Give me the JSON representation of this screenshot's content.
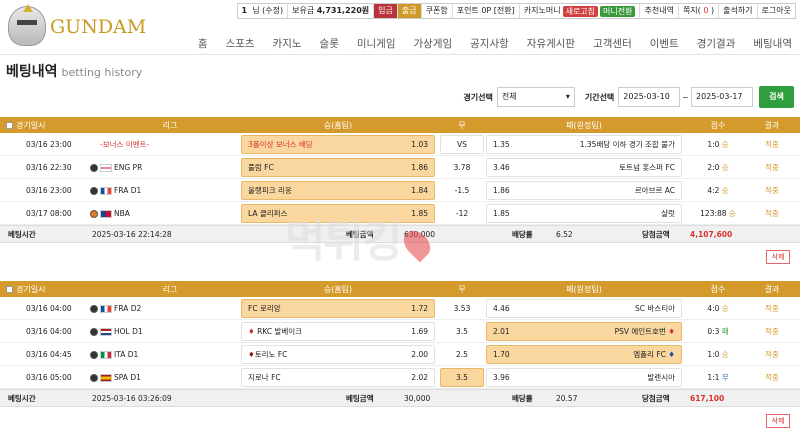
{
  "brand": {
    "name": "GUNDAM"
  },
  "topbar": {
    "level": "1",
    "user": "님 (수정)",
    "balance_label": "보유금",
    "balance": "4,731,220원",
    "deposit": "입금",
    "withdraw": "출금",
    "coupon": "쿠폰함",
    "point_label": "포인트",
    "point": "0P [전환]",
    "casino_label": "카지노머니",
    "casino_new": "새로고침",
    "mini": "머니전환",
    "recommend": "추천내역",
    "note_label": "쪽지(",
    "note": "0",
    "note_end": ")",
    "attendance": "출석하기",
    "logout": "로그아웃"
  },
  "nav": [
    "홈",
    "스포츠",
    "카지노",
    "슬롯",
    "미니게임",
    "가상게임",
    "공지사항",
    "자유게시판",
    "고객센터",
    "이벤트",
    "경기결과",
    "베팅내역"
  ],
  "page": {
    "title": "베팅내역",
    "subtitle": "betting history"
  },
  "filters": {
    "game_label": "경기선택",
    "game_value": "전체",
    "period_label": "기간선택",
    "from": "2025-03-10",
    "to": "2025-03-17",
    "search": "검색"
  },
  "headers": {
    "date": "경기일시",
    "league": "리그",
    "home": "승(홈팀)",
    "draw": "무",
    "away": "패(원정팀)",
    "score": "점수",
    "result": "결과"
  },
  "slips": [
    {
      "rows": [
        {
          "date": "03/16 23:00",
          "league": "-보너스 이벤트-",
          "home": "3폴이상 보너스 배당",
          "home_odds": "1.03",
          "draw": "VS",
          "away_odds": "1.35",
          "away": "1.35배당 이하 경기 조합 불가",
          "score": "1:0",
          "score_mark": "승",
          "result": "적중",
          "sel": "home"
        },
        {
          "date": "03/16 22:30",
          "league": "ENG PR",
          "home": "풀럼 FC",
          "home_odds": "1.86",
          "draw": "3.78",
          "away_odds": "3.46",
          "away": "토트넘 홋스퍼 FC",
          "score": "2:0",
          "score_mark": "승",
          "result": "적중",
          "sel": "home"
        },
        {
          "date": "03/16 23:00",
          "league": "FRA D1",
          "home": "올랭피크 리옹",
          "home_odds": "1.84",
          "draw": "-1.5",
          "away_odds": "1.86",
          "away": "르아브르 AC",
          "score": "4:2",
          "score_mark": "승",
          "result": "적중",
          "sel": "home"
        },
        {
          "date": "03/17 08:00",
          "league": "NBA",
          "home": "LA 클리퍼스",
          "home_odds": "1.85",
          "draw": "-12",
          "away_odds": "1.85",
          "away": "샬럿",
          "score": "123:88",
          "score_mark": "승",
          "result": "적중",
          "sel": "home"
        }
      ],
      "foot": {
        "time_label": "베팅시간",
        "time": "2025-03-16 22:14:28",
        "amount_label": "베팅금액",
        "amount": "630,000",
        "rate_label": "배당률",
        "rate": "6.52",
        "win_label": "당첨금액",
        "win": "4,107,600"
      },
      "delete": "삭제"
    },
    {
      "rows": [
        {
          "date": "03/16 04:00",
          "league": "FRA D2",
          "home": "FC 로리앙",
          "home_odds": "1.72",
          "draw": "3.53",
          "away_odds": "4.46",
          "away": "SC 바스티아",
          "score": "4:0",
          "score_mark": "승",
          "result": "적중",
          "sel": "home"
        },
        {
          "date": "03/16 04:00",
          "league": "HOL D1",
          "home": "RKC 발베이크",
          "home_odds": "1.69",
          "draw": "3.5",
          "away_odds": "2.01",
          "away": "PSV 에인트호번",
          "score": "0:3",
          "score_mark": "패",
          "result": "적중",
          "sel": "away"
        },
        {
          "date": "03/16 04:45",
          "league": "ITA D1",
          "home": "토리노 FC",
          "home_odds": "2.00",
          "draw": "2.5",
          "away_odds": "1.70",
          "away": "엠폴리 FC",
          "score": "1:0",
          "score_mark": "승",
          "result": "적중",
          "sel": "away"
        },
        {
          "date": "03/16 05:00",
          "league": "SPA D1",
          "home": "지로나 FC",
          "home_odds": "2.02",
          "draw": "3.5",
          "away_odds": "3.96",
          "away": "발렌시아",
          "score": "1:1",
          "score_mark": "무",
          "result": "적중",
          "sel": "draw"
        }
      ],
      "foot": {
        "time_label": "베팅시간",
        "time": "2025-03-16 03:26:09",
        "amount_label": "베팅금액",
        "amount": "30,000",
        "rate_label": "배당률",
        "rate": "20.57",
        "win_label": "당첨금액",
        "win": "617,100"
      },
      "delete": "삭제"
    }
  ],
  "watermark": "먹튀킹"
}
